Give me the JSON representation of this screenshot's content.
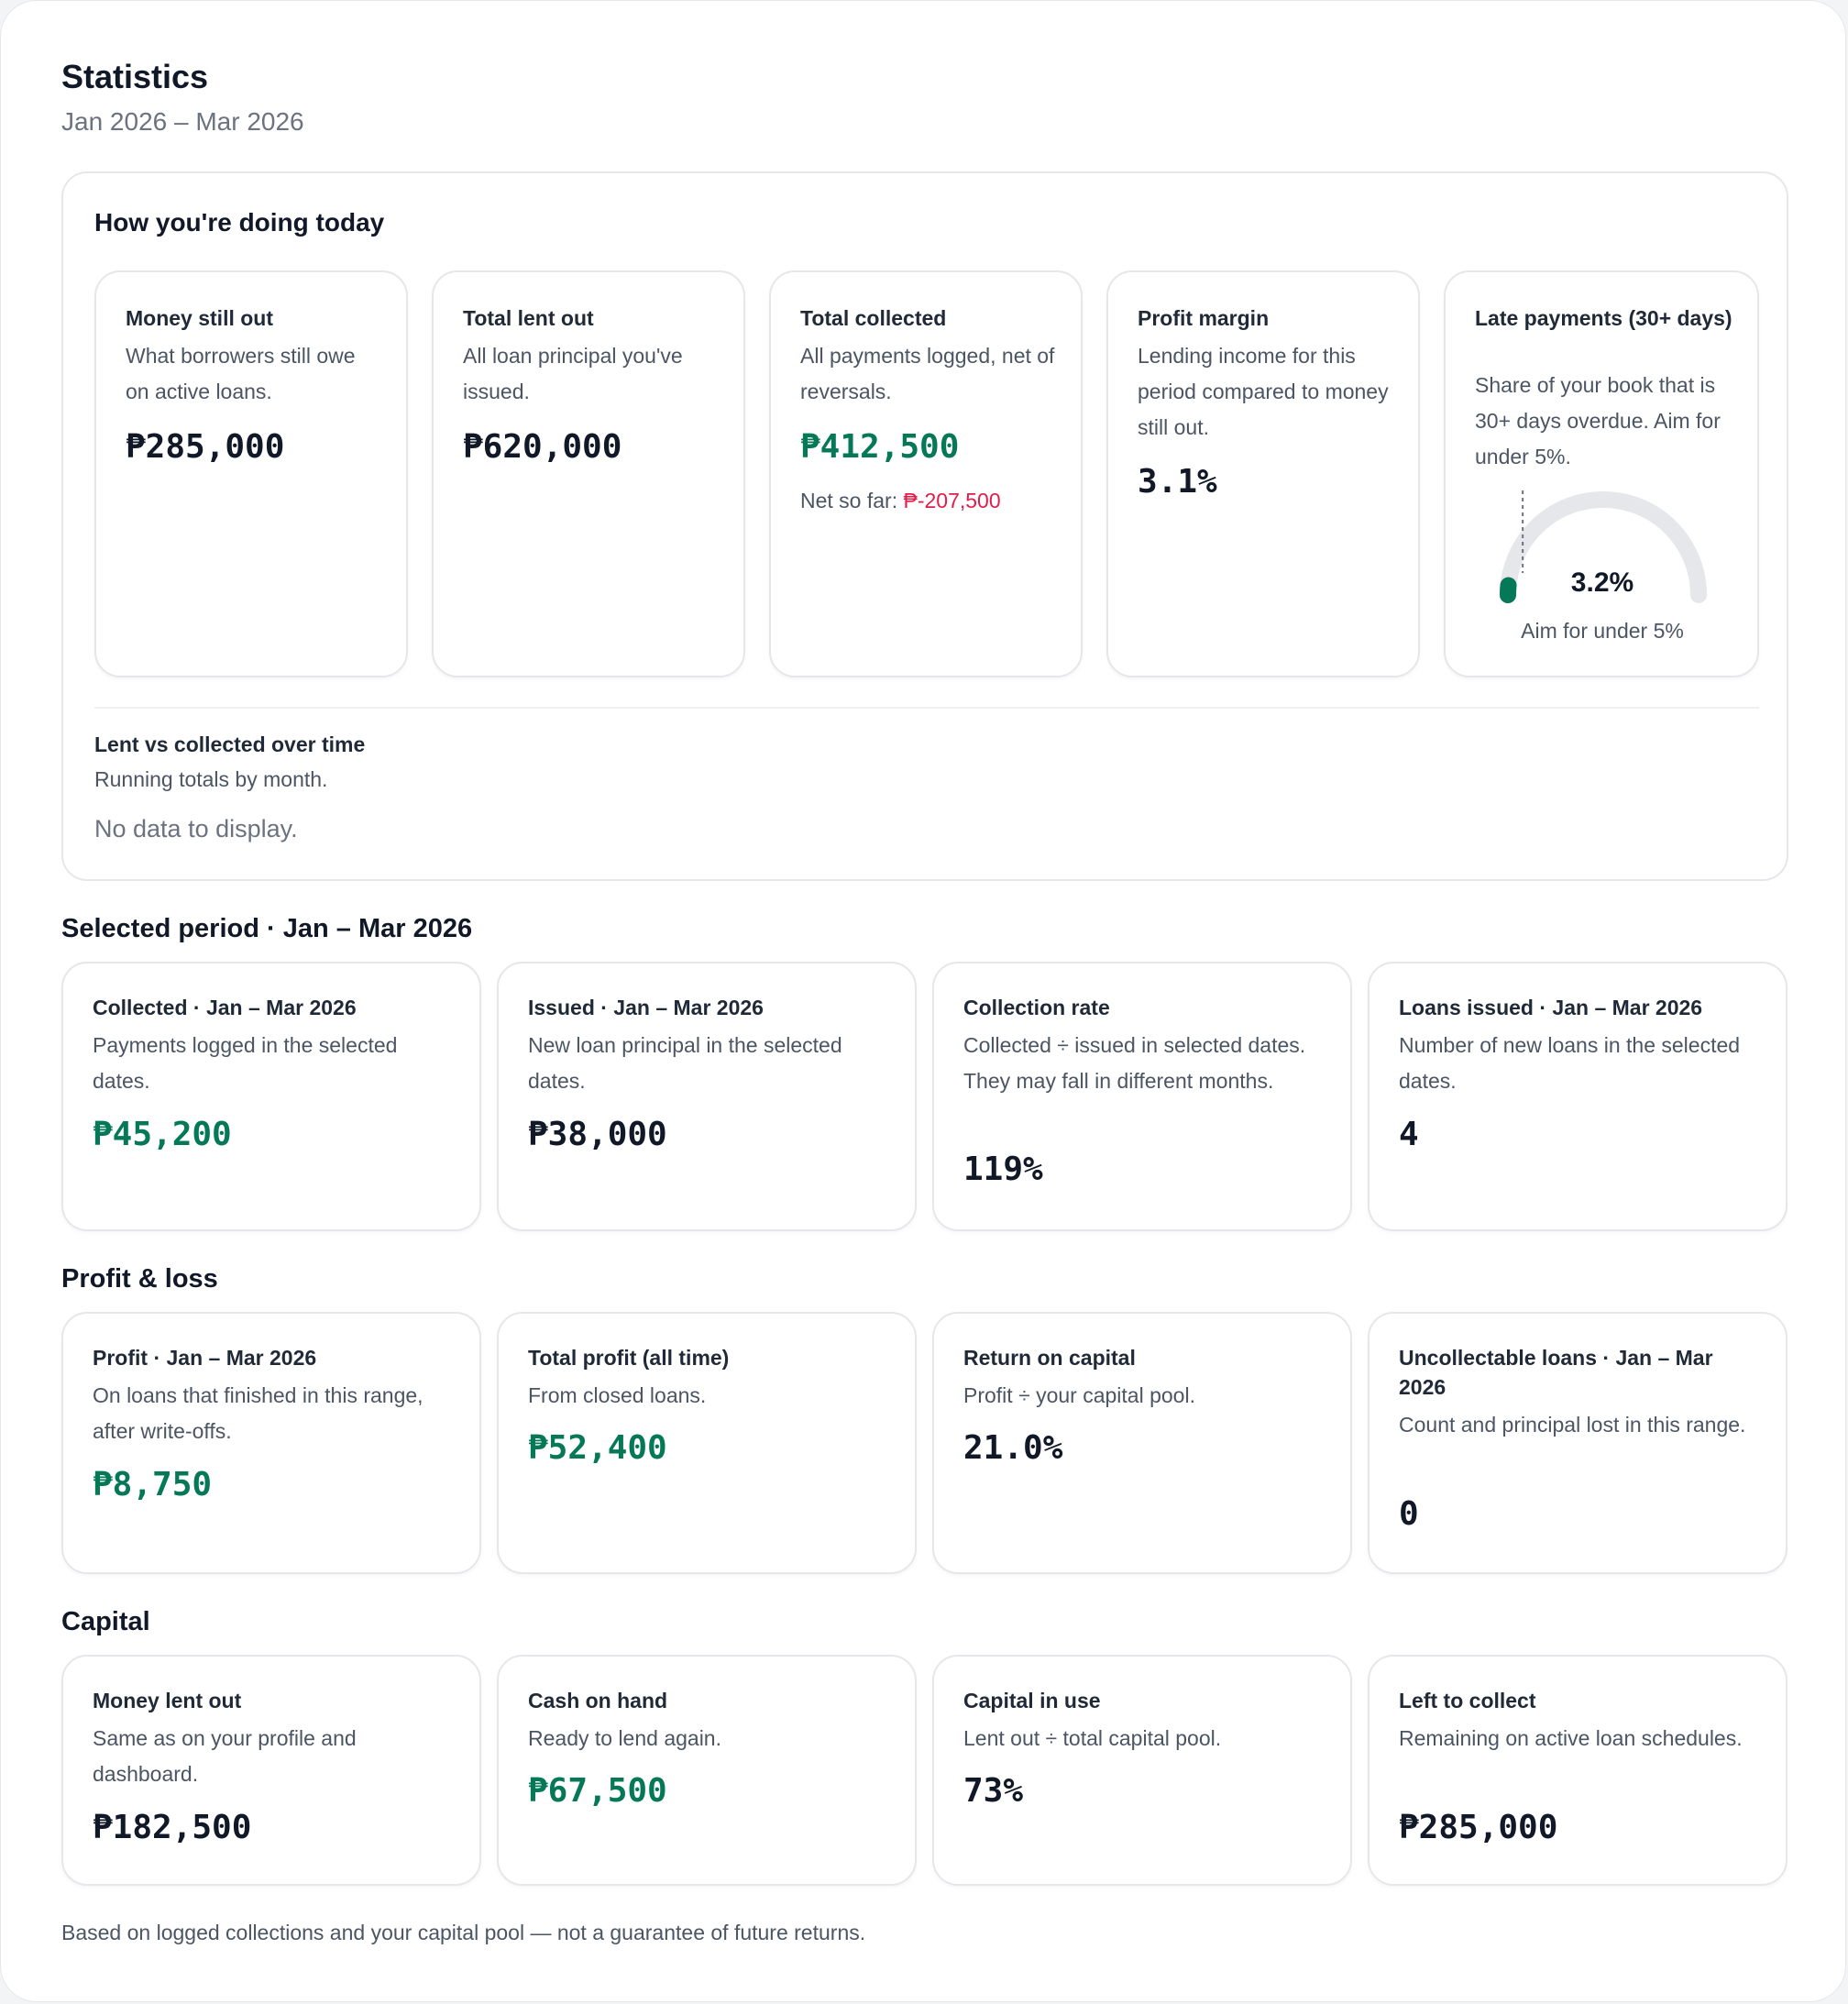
{
  "header": {
    "title": "Statistics",
    "date_range": "Jan 2026 – Mar 2026"
  },
  "today": {
    "heading": "How you're doing today",
    "kpis": [
      {
        "title": "Money still out",
        "desc": "What borrowers still owe on active loans.",
        "value": "₱285,000"
      },
      {
        "title": "Total lent out",
        "desc": "All loan principal you've issued.",
        "value": "₱620,000"
      },
      {
        "title": "Total collected",
        "desc": "All payments logged, net of reversals.",
        "value": "₱412,500",
        "net_label": "Net so far:",
        "net_value": "₱-207,500"
      },
      {
        "title": "Profit margin",
        "desc": "Lending income for this period compared to money still out.",
        "value": "3.1%"
      },
      {
        "title": "Late payments (30+ days)",
        "desc": "Share of your book that is 30+ days overdue. Aim for under 5%.",
        "value": "3.2%",
        "gauge_caption": "Aim for under 5%",
        "gauge_fraction": 0.032,
        "target_fraction": 0.05
      }
    ],
    "chart": {
      "title": "Lent vs collected over time",
      "desc": "Running totals by month.",
      "empty": "No data to display."
    }
  },
  "selected_period": {
    "heading": "Selected period · Jan – Mar 2026",
    "cards": [
      {
        "title": "Collected · Jan – Mar 2026",
        "desc": "Payments logged in the selected dates.",
        "value": "₱45,200"
      },
      {
        "title": "Issued · Jan – Mar 2026",
        "desc": "New loan principal in the selected dates.",
        "value": "₱38,000"
      },
      {
        "title": "Collection rate",
        "desc": "Collected ÷ issued in selected dates. They may fall in different months.",
        "value": "119%"
      },
      {
        "title": "Loans issued · Jan – Mar 2026",
        "desc": "Number of new loans in the selected dates.",
        "value": "4"
      }
    ]
  },
  "profit_loss": {
    "heading": "Profit & loss",
    "cards": [
      {
        "title": "Profit · Jan – Mar 2026",
        "desc": "On loans that finished in this range, after write-offs.",
        "value": "₱8,750"
      },
      {
        "title": "Total profit (all time)",
        "desc": "From closed loans.",
        "value": "₱52,400"
      },
      {
        "title": "Return on capital",
        "desc": "Profit ÷ your capital pool.",
        "value": "21.0%"
      },
      {
        "title": "Uncollectable loans · Jan – Mar 2026",
        "desc": "Count and principal lost in this range.",
        "value": "0"
      }
    ]
  },
  "capital": {
    "heading": "Capital",
    "cards": [
      {
        "title": "Money lent out",
        "desc": "Same as on your profile and dashboard.",
        "value": "₱182,500"
      },
      {
        "title": "Cash on hand",
        "desc": "Ready to lend again.",
        "value": "₱67,500"
      },
      {
        "title": "Capital in use",
        "desc": "Lent out ÷ total capital pool.",
        "value": "73%"
      },
      {
        "title": "Left to collect",
        "desc": "Remaining on active loan schedules.",
        "value": "₱285,000"
      }
    ]
  },
  "footnote": "Based on logged collections and your capital pool — not a guarantee of future returns.",
  "colors": {
    "positive": "#047857",
    "negative": "#e11d48",
    "gauge_track": "#e5e7eb",
    "gauge_fill": "#047857"
  }
}
